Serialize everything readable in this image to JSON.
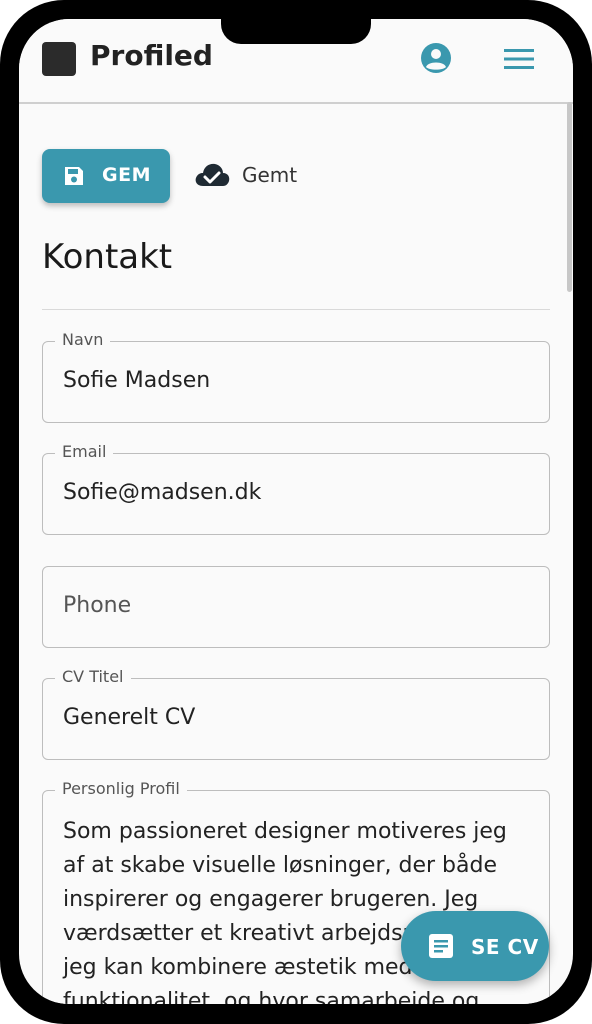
{
  "header": {
    "brand": "Profiled",
    "user_icon": "account-circle-icon",
    "menu_icon": "hamburger-menu-icon"
  },
  "toolbar": {
    "save_label": "GEM",
    "save_icon": "floppy-disk-icon",
    "status_icon": "cloud-check-icon",
    "status_text": "Gemt"
  },
  "section": {
    "title": "Kontakt"
  },
  "fields": {
    "name": {
      "label": "Navn",
      "value": "Sofie Madsen"
    },
    "email": {
      "label": "Email",
      "value": "Sofie@madsen.dk"
    },
    "phone": {
      "placeholder": "Phone"
    },
    "cv_title": {
      "label": "CV Titel",
      "value": "Generelt CV"
    },
    "profile": {
      "label": "Personlig Profil",
      "value": "Som passioneret designer motiveres jeg af at skabe visuelle løsninger, der både inspirerer og engagerer brugeren. Jeg værdsætter et kreativt arbejdsmiljø, hvor jeg kan kombinere æstetik med funktionalitet, og hvor samarbejde og"
    }
  },
  "fab": {
    "label": "SE CV",
    "icon": "document-icon"
  },
  "colors": {
    "accent": "#3a98ae",
    "text": "#222222",
    "background": "#fafafa"
  }
}
